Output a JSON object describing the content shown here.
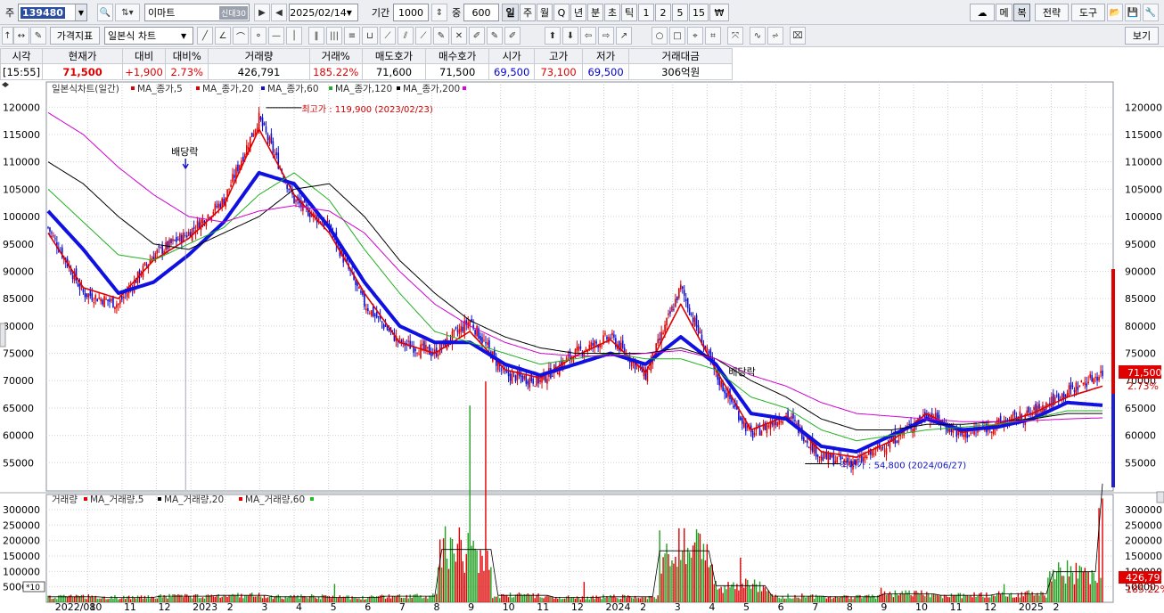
{
  "top": {
    "prefix": "주",
    "code": "139480",
    "name": "이마트",
    "name_tag": "신대30",
    "date": "2025/02/14",
    "period_label": "기간",
    "period": "1000",
    "zoom_label": "중",
    "zoom": "600",
    "periods": [
      "일",
      "주",
      "월",
      "Q",
      "년",
      "분",
      "초",
      "틱",
      "1",
      "2",
      "5",
      "15",
      "₩"
    ],
    "right_buttons": [
      "메",
      "복",
      "전략",
      "도구"
    ]
  },
  "toolbar2": {
    "indicator_btn": "가격지표",
    "chart_type": "일본식 차트",
    "view_btn": "보기"
  },
  "quote": {
    "headers": [
      "시각",
      "현재가",
      "대비",
      "대비%",
      "거래량",
      "거래%",
      "매도호가",
      "매수호가",
      "시가",
      "고가",
      "저가",
      "거래대금"
    ],
    "values": [
      "[15:55]",
      "71,500",
      "+1,900",
      "2.73%",
      "426,791",
      "185.22%",
      "71,600",
      "71,500",
      "69,500",
      "73,100",
      "69,500",
      "306억원"
    ]
  },
  "price_legend": {
    "chart": "일본식차트(일간)",
    "items": [
      {
        "label": "MA_종가,5",
        "color": "#e00000"
      },
      {
        "label": "MA_종가,20",
        "color": "#e00000"
      },
      {
        "label": "MA_종가,60",
        "color": "#1010d0"
      },
      {
        "label": "MA_종가,120",
        "color": "#20b020"
      },
      {
        "label": "MA_종가,200",
        "color": "#000000"
      }
    ],
    "end_color": "#e000e0"
  },
  "volume_legend": {
    "chart": "거래량",
    "items": [
      {
        "label": "MA_거래량,5",
        "color": "#e00000"
      },
      {
        "label": "MA_거래량,20",
        "color": "#000000"
      },
      {
        "label": "MA_거래량,60",
        "color": "#e00000"
      }
    ],
    "end_color": "#20c020"
  },
  "annotations": {
    "high": "최고가 : 119,900 (2023/02/23)",
    "low": "최저가 : 54,800 (2024/06/27)",
    "div1": "배당락",
    "div2": "배당락",
    "current_price": "71,500",
    "current_pct": "2.73%",
    "current_volume": "426,791",
    "volume_pct": "185.22%",
    "vol_unit": "*10"
  },
  "chart_data": [
    {
      "type": "candlestick",
      "title": "일본식차트(일간)",
      "ylim": [
        50000,
        122000
      ],
      "yticks": [
        55000,
        60000,
        65000,
        70000,
        75000,
        80000,
        85000,
        90000,
        95000,
        100000,
        105000,
        110000,
        115000,
        120000
      ],
      "x_ticks": [
        "2022/08",
        "10",
        "11",
        "12",
        "2023",
        "2",
        "3",
        "4",
        "5",
        "6",
        "7",
        "8",
        "9",
        "10",
        "11",
        "12",
        "2024",
        "2",
        "3",
        "4",
        "5",
        "6",
        "7",
        "8",
        "9",
        "10",
        "11",
        "12",
        "2025",
        "2"
      ],
      "close_series": {
        "dates": [
          "2022/08",
          "2022/09",
          "2022/10",
          "2022/11",
          "2022/12",
          "2023/01",
          "2023/02",
          "2023/03",
          "2023/04",
          "2023/05",
          "2023/06",
          "2023/07",
          "2023/08",
          "2023/09",
          "2023/10",
          "2023/11",
          "2023/12",
          "2024/01",
          "2024/02",
          "2024/03",
          "2024/04",
          "2024/05",
          "2024/06",
          "2024/07",
          "2024/08",
          "2024/09",
          "2024/10",
          "2024/11",
          "2024/12",
          "2025/01",
          "2025/02"
        ],
        "values": [
          98000,
          86000,
          84000,
          93000,
          97000,
          103000,
          118000,
          103000,
          98000,
          84000,
          77000,
          75000,
          81000,
          71000,
          70000,
          75000,
          78000,
          71000,
          87000,
          71000,
          60000,
          64000,
          56000,
          55000,
          59000,
          64000,
          60000,
          62000,
          64000,
          68000,
          71500
        ]
      },
      "series": [
        {
          "name": "MA_종가,5",
          "values": [
            97000,
            87000,
            85000,
            92000,
            96000,
            102000,
            116000,
            104000,
            97000,
            86000,
            77000,
            75000,
            79000,
            72000,
            70500,
            74500,
            77500,
            71500,
            84000,
            72000,
            61000,
            63500,
            57000,
            56000,
            59000,
            64000,
            60500,
            62000,
            64000,
            67000,
            69000
          ]
        },
        {
          "name": "MA_종가,60",
          "values": [
            101000,
            94000,
            86000,
            88000,
            93000,
            99000,
            108000,
            106000,
            98000,
            88000,
            80000,
            77000,
            77000,
            73000,
            71000,
            73000,
            75000,
            73000,
            78000,
            73000,
            64000,
            63000,
            58000,
            57000,
            60000,
            63000,
            61000,
            61500,
            63000,
            66000,
            65500
          ]
        },
        {
          "name": "MA_종가,120",
          "values": [
            105000,
            99000,
            93000,
            92000,
            95000,
            98000,
            104000,
            108000,
            103000,
            94000,
            86000,
            79000,
            77000,
            75000,
            73000,
            74000,
            75000,
            74000,
            74000,
            72000,
            67000,
            65000,
            61000,
            59000,
            60000,
            61000,
            61500,
            62000,
            63000,
            64500,
            64500
          ]
        },
        {
          "name": "MA_종가,200",
          "values": [
            110000,
            106000,
            100000,
            95000,
            94000,
            97000,
            100000,
            105000,
            106000,
            100000,
            92000,
            86000,
            81000,
            78000,
            76000,
            75000,
            75000,
            75000,
            76000,
            74000,
            70000,
            67000,
            63000,
            61000,
            61000,
            62000,
            62000,
            62500,
            63000,
            64000,
            64000
          ]
        },
        {
          "name": "MA_종가,20",
          "values": [
            119000,
            115000,
            109000,
            104000,
            100000,
            99000,
            101000,
            102000,
            101000,
            97000,
            90000,
            84000,
            80000,
            77000,
            75000,
            74500,
            74500,
            75000,
            75500,
            74000,
            71000,
            69000,
            66000,
            64000,
            63500,
            63000,
            62500,
            62500,
            62700,
            63000,
            63200
          ]
        }
      ]
    },
    {
      "type": "bar",
      "title": "거래량",
      "ylim": [
        0,
        320000
      ],
      "yticks": [
        50000,
        100000,
        150000,
        200000,
        250000,
        300000
      ],
      "dates": [
        "2022/08",
        "2022/10",
        "2022/12",
        "2023/02",
        "2023/04",
        "2023/06",
        "2023/08",
        "2023/09",
        "2023/10",
        "2023/12",
        "2024/01",
        "2024/02",
        "2024/03",
        "2024/05",
        "2024/07",
        "2024/08",
        "2024/10",
        "2024/12",
        "2025/01",
        "2025/02"
      ],
      "values": [
        20000,
        18000,
        22000,
        25000,
        20000,
        18000,
        22000,
        190000,
        25000,
        18000,
        20000,
        185000,
        60000,
        22000,
        20000,
        30000,
        25000,
        30000,
        110000,
        426791
      ]
    }
  ]
}
